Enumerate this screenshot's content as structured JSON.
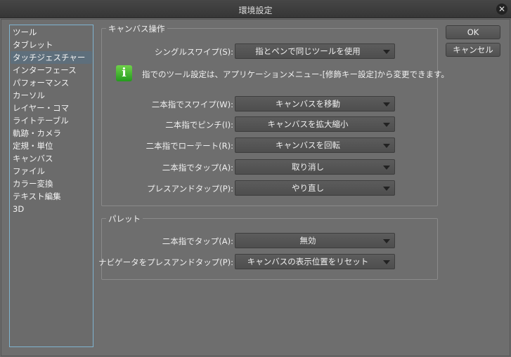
{
  "window": {
    "title": "環境設定"
  },
  "sidebar": {
    "items": [
      "ツール",
      "タブレット",
      "タッチジェスチャー",
      "インターフェース",
      "パフォーマンス",
      "カーソル",
      "レイヤー・コマ",
      "ライトテーブル",
      "軌跡・カメラ",
      "定規・単位",
      "キャンバス",
      "ファイル",
      "カラー変換",
      "テキスト編集",
      "3D"
    ],
    "selected": 2
  },
  "canvas_group": {
    "title": "キャンバス操作",
    "single_swipe": {
      "label": "シングルスワイプ(S):",
      "value": "指とペンで同じツールを使用"
    },
    "info": "指でのツール設定は、アプリケーションメニュー-[修飾キー設定]から変更できます。",
    "rows": [
      {
        "label": "二本指でスワイプ(W):",
        "value": "キャンバスを移動"
      },
      {
        "label": "二本指でピンチ(I):",
        "value": "キャンバスを拡大縮小"
      },
      {
        "label": "二本指でローテート(R):",
        "value": "キャンバスを回転"
      },
      {
        "label": "二本指でタップ(A):",
        "value": "取り消し"
      },
      {
        "label": "プレスアンドタップ(P):",
        "value": "やり直し"
      }
    ]
  },
  "palette_group": {
    "title": "パレット",
    "rows": [
      {
        "label": "二本指でタップ(A):",
        "value": "無効"
      },
      {
        "label": "ナビゲータをプレスアンドタップ(P):",
        "value": "キャンバスの表示位置をリセット"
      }
    ]
  },
  "buttons": {
    "ok": "OK",
    "cancel": "キャンセル"
  }
}
